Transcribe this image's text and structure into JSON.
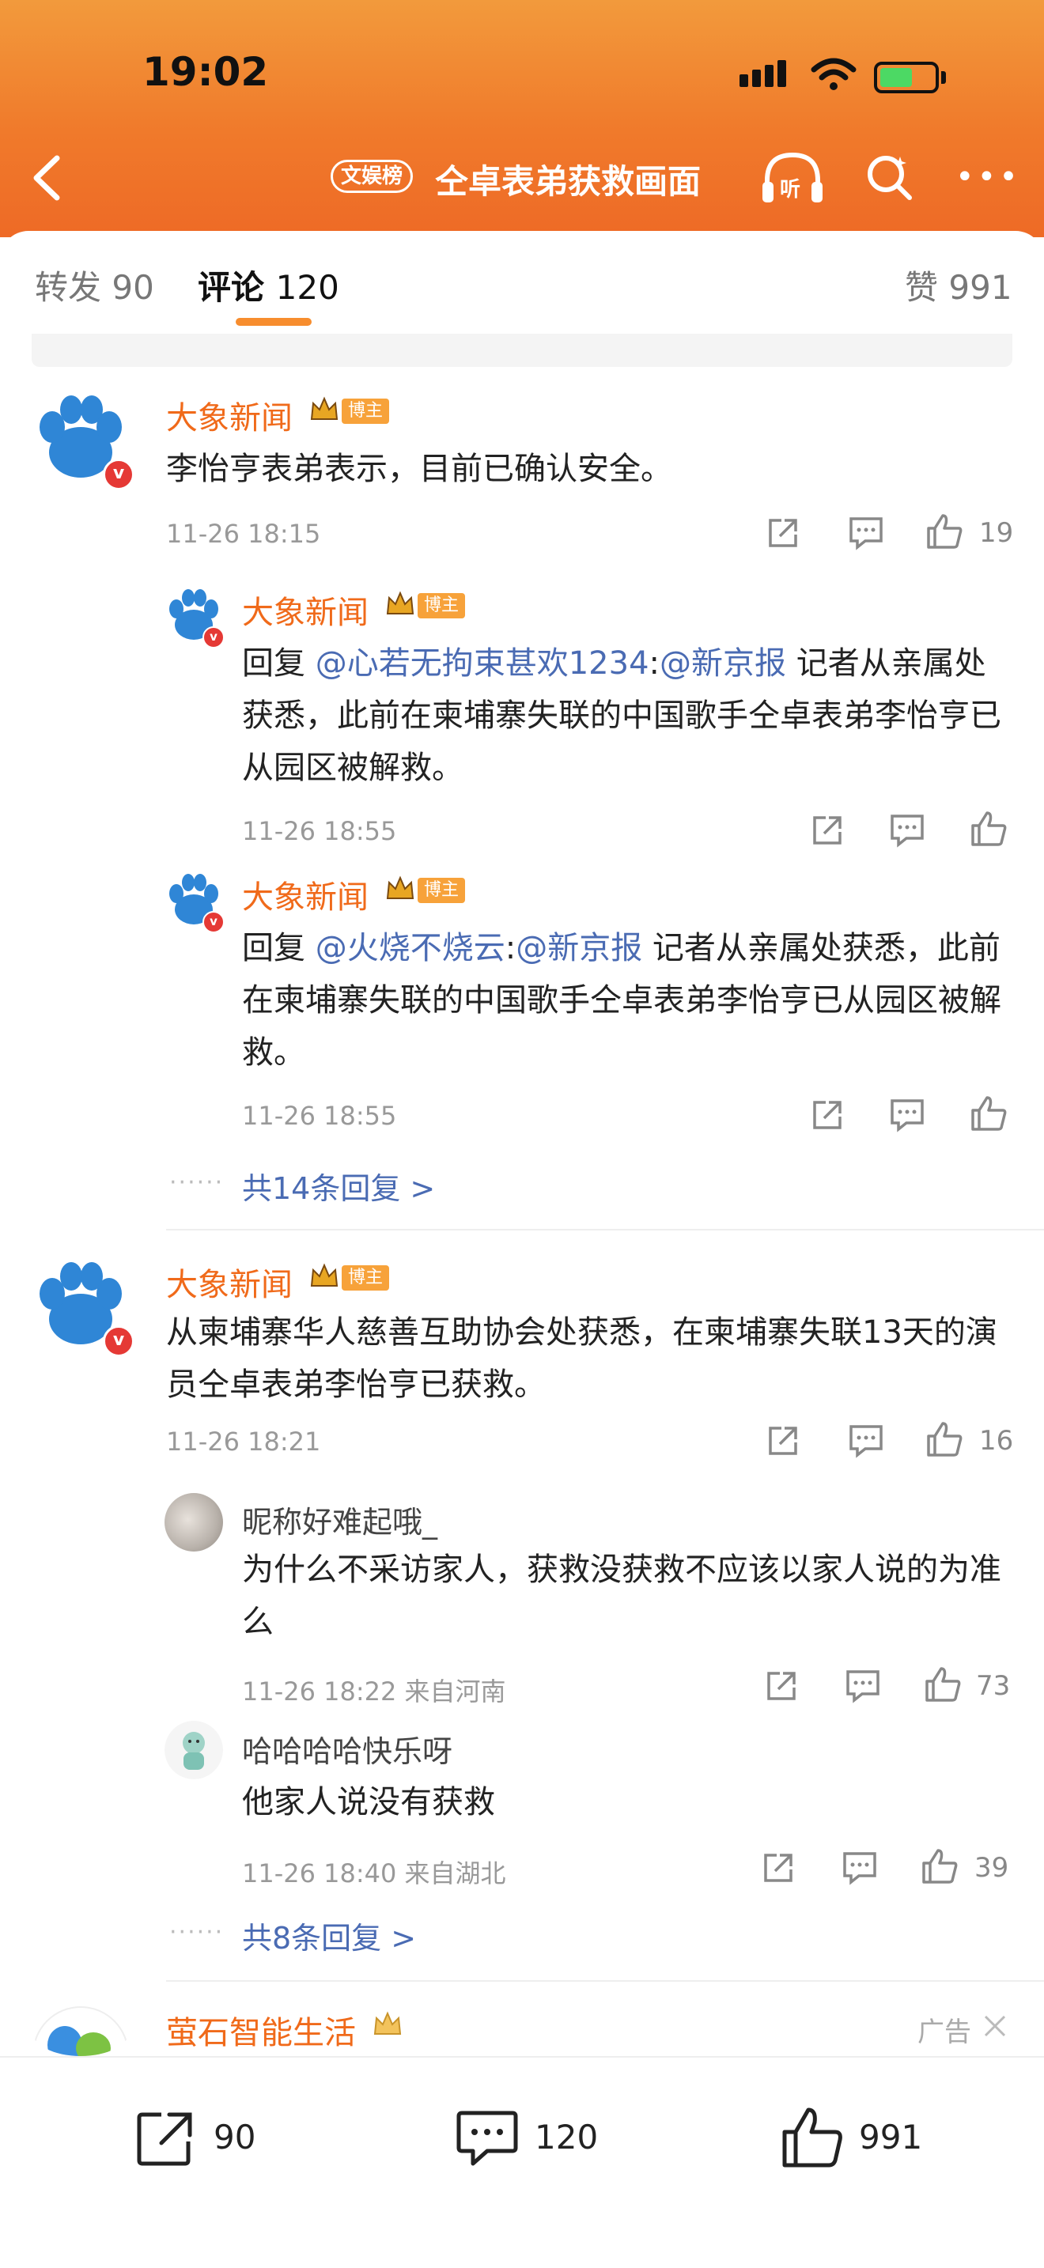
{
  "status_bar": {
    "time": "19:02"
  },
  "header": {
    "tag": "文娱榜",
    "title": "仝卓表弟获救画面",
    "listen_label": "听"
  },
  "tabs": [
    {
      "label": "转发",
      "count": "90"
    },
    {
      "label": "评论",
      "count": "120"
    },
    {
      "label": "赞",
      "count": "991"
    }
  ],
  "comments": [
    {
      "user": "大象新闻",
      "badge": "博主",
      "text": "李怡亨表弟表示，目前已确认安全。",
      "time": "11-26 18:15",
      "likes": "19",
      "replies": [
        {
          "user": "大象新闻",
          "badge": "博主",
          "prefix": "回复 ",
          "mention": "@心若无拘束甚欢1234",
          "sep": ":",
          "mention2": "@新京报",
          "text": " 记者从亲属处获悉，此前在柬埔寨失联的中国歌手仝卓表弟李怡亨已从园区被解救。",
          "time": "11-26 18:55"
        },
        {
          "user": "大象新闻",
          "badge": "博主",
          "prefix": "回复 ",
          "mention": "@火烧不烧云",
          "sep": ":",
          "mention2": "@新京报",
          "text": " 记者从亲属处获悉，此前在柬埔寨失联的中国歌手仝卓表弟李怡亨已从园区被解救。",
          "time": "11-26 18:55"
        }
      ],
      "more_replies": "共14条回复 >"
    },
    {
      "user": "大象新闻",
      "badge": "博主",
      "text": "从柬埔寨华人慈善互助协会处获悉，在柬埔寨失联13天的演员仝卓表弟李怡亨已获救。",
      "time": "11-26 18:21",
      "likes": "16",
      "replies": [
        {
          "user": "昵称好难起哦_",
          "text": "为什么不采访家人，获救没获救不应该以家人说的为准么",
          "time": "11-26 18:22",
          "location": "来自河南",
          "likes": "73"
        },
        {
          "user": "哈哈哈哈快乐呀",
          "text": "他家人说没有获救",
          "time": "11-26 18:40",
          "location": "来自湖北",
          "likes": "39"
        }
      ],
      "more_replies": "共8条回复 >"
    }
  ],
  "ad": {
    "user": "萤石智能生活",
    "label": "广告"
  },
  "bottom_bar": {
    "repost": "90",
    "comment": "120",
    "like": "991"
  },
  "colors": {
    "accent": "#f07a2b",
    "username": "#f06a1a",
    "mention": "#4a6bb3"
  }
}
